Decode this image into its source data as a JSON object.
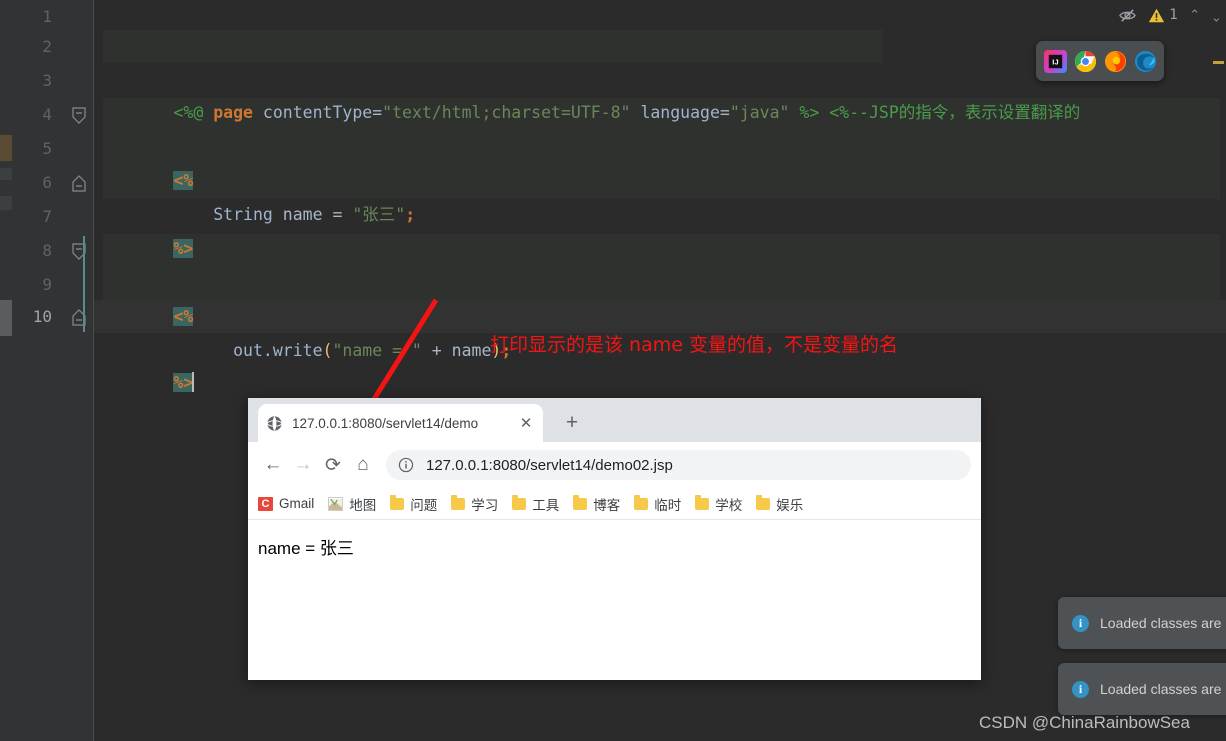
{
  "editor": {
    "status": {
      "eye_icon": "eye-slash-icon",
      "warning_icon": "warning-triangle-icon",
      "warning_count": "1",
      "prev_icon": "chevron-up-icon",
      "next_icon": "chevron-down-icon"
    },
    "lines": [
      {
        "number": "1",
        "text": ""
      },
      {
        "number": "2",
        "text": "<%@ page contentType=\"text/html;charset=UTF-8\" language=\"java\" %> <%--JSP的指令，表示设置翻译的"
      },
      {
        "number": "3",
        "text": ""
      },
      {
        "number": "4",
        "text": "<%"
      },
      {
        "number": "5",
        "text": "  String name = \"张三\";"
      },
      {
        "number": "6",
        "text": "%>"
      },
      {
        "number": "7",
        "text": ""
      },
      {
        "number": "8",
        "text": "<%"
      },
      {
        "number": "9",
        "text": "    out.write(\"name = \" + name);"
      },
      {
        "number": "10",
        "text": "%>"
      }
    ],
    "tokens": {
      "l2_directive_open": "<%@",
      "l2_keyword": "page",
      "l2_attr1": "contentType",
      "l2_eq": "=",
      "l2_str1": "\"text/html;charset=UTF-8\"",
      "l2_attr2": "language",
      "l2_str2": "\"java\"",
      "l2_directive_close": "%>",
      "l2_comment": "<%--JSP的指令，表示设置翻译的",
      "l4_scriptlet_open": "<%",
      "l5_type": "String",
      "l5_var": "name",
      "l5_eq": "=",
      "l5_str": "\"张三\"",
      "l5_semi": ";",
      "l6_scriptlet_close": "%>",
      "l8_scriptlet_open": "<%",
      "l9_obj": "out",
      "l9_dot": ".",
      "l9_method": "write",
      "l9_lparen": "(",
      "l9_str": "\"name = \"",
      "l9_plus": "+",
      "l9_arg": "name",
      "l9_rparen": ")",
      "l9_semi": ";",
      "l10_scriptlet_close": "%>"
    }
  },
  "launcher": {
    "items": [
      {
        "name": "intellij-idea-icon",
        "label": "IJ"
      },
      {
        "name": "chrome-icon",
        "label": ""
      },
      {
        "name": "firefox-icon",
        "label": ""
      },
      {
        "name": "edge-icon",
        "label": ""
      }
    ]
  },
  "annotation": {
    "text": "打印显示的是该 name 变量的值，不是变量的名",
    "color": "#f51414"
  },
  "browser": {
    "tab": {
      "favicon": "globe-icon",
      "title": "127.0.0.1:8080/servlet14/demo",
      "close_label": "✕"
    },
    "new_tab_label": "+",
    "nav": {
      "back": "←",
      "forward": "→",
      "reload": "⟳",
      "home": "⌂"
    },
    "omnibox": {
      "info_icon": "info-circle-icon",
      "url": "127.0.0.1:8080/servlet14/demo02.jsp"
    },
    "bookmarks": [
      {
        "label": "Gmail",
        "icon": "gmail-icon"
      },
      {
        "label": "地图",
        "icon": "maps-icon"
      },
      {
        "label": "问题",
        "icon": "folder-icon"
      },
      {
        "label": "学习",
        "icon": "folder-icon"
      },
      {
        "label": "工具",
        "icon": "folder-icon"
      },
      {
        "label": "博客",
        "icon": "folder-icon"
      },
      {
        "label": "临时",
        "icon": "folder-icon"
      },
      {
        "label": "学校",
        "icon": "folder-icon"
      },
      {
        "label": "娱乐",
        "icon": "folder-icon"
      }
    ],
    "page_content": "name = 张三"
  },
  "notifications": [
    {
      "icon": "info-icon",
      "text": "Loaded classes are"
    },
    {
      "icon": "info-icon",
      "text": "Loaded classes are"
    }
  ],
  "watermark": "CSDN @ChinaRainbowSea",
  "colors": {
    "editor_bg": "#2b2b2b",
    "gutter_bg": "#313335",
    "block_bg": "#2f312f",
    "current_line_bg": "#323232",
    "keyword": "#cc7832",
    "string": "#6a8759",
    "comment": "#4a9c4a",
    "identifier": "#a9b7c6",
    "accent_red": "#f51414",
    "toast_bg": "#4e5254",
    "info_blue": "#3592c4",
    "warning_yellow": "#bfa23a"
  }
}
